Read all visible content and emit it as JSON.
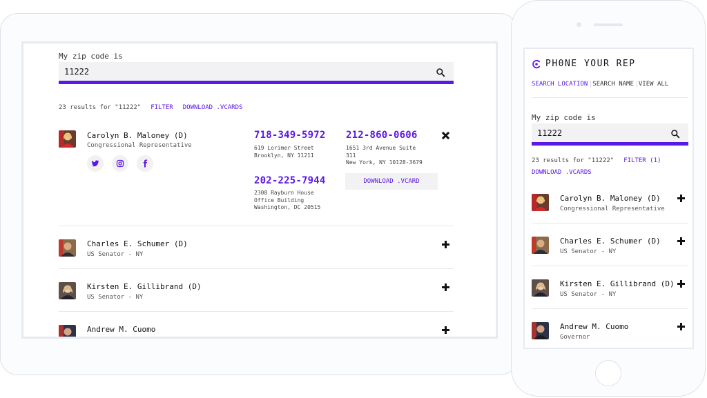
{
  "colors": {
    "accent": "#5b17e6",
    "input_bg": "#f2f2f4"
  },
  "tablet": {
    "zip_label": "My zip code is",
    "zip_value": "11222",
    "results_text": "23 results for \"11222\"",
    "filter_label": "FILTER",
    "download_vcards_label": "DOWNLOAD .VCARDS",
    "expanded_rep": {
      "name": "Carolyn B. Maloney (D)",
      "title": "Congressional Representative",
      "social": [
        "twitter-icon",
        "instagram-icon",
        "facebook-icon"
      ],
      "offices": [
        {
          "phone": "718-349-5972",
          "address": [
            "619 Lorimer Street",
            "Brooklyn, NY 11211"
          ]
        },
        {
          "phone": "212-860-0606",
          "address": [
            "1651 3rd Avenue Suite",
            "311",
            "New York, NY 10128-3679"
          ]
        },
        {
          "phone": "202-225-7944",
          "address": [
            "2308 Rayburn House",
            "Office Building",
            "Washington, DC 20515"
          ]
        }
      ],
      "download_vcard_label": "DOWNLOAD .VCARD"
    },
    "reps": [
      {
        "name": "Charles E. Schumer (D)",
        "title": "US Senator - NY"
      },
      {
        "name": "Kirsten E. Gillibrand (D)",
        "title": "US Senator - NY"
      },
      {
        "name": "Andrew M. Cuomo",
        "title": ""
      }
    ]
  },
  "phone": {
    "brand": "PH0NE YOUR REP",
    "tabs": [
      "SEARCH LOCATION",
      "SEARCH NAME",
      "VIEW ALL"
    ],
    "zip_label": "My zip code is",
    "zip_value": "11222",
    "results_text": "23 results for \"11222\"",
    "filter_label": "FILTER (1)",
    "download_vcards_label": "DOWNLOAD .VCARDS",
    "reps": [
      {
        "name": "Carolyn B. Maloney (D)",
        "title": "Congressional Representative"
      },
      {
        "name": "Charles E. Schumer (D)",
        "title": "US Senator - NY"
      },
      {
        "name": "Kirsten E. Gillibrand (D)",
        "title": "US Senator - NY"
      },
      {
        "name": "Andrew M. Cuomo",
        "title": "Governor"
      }
    ]
  }
}
